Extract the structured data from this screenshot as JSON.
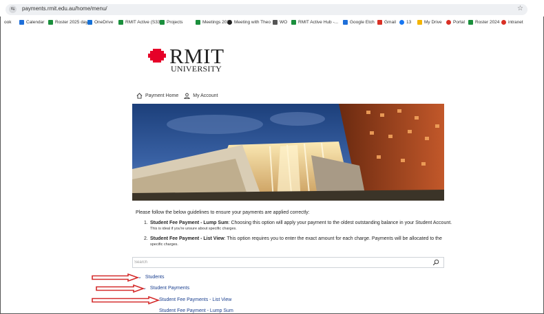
{
  "browser": {
    "url": "payments.rmit.edu.au/home/menu/",
    "bookmarks": [
      {
        "label": "ook",
        "color": "#ffffff"
      },
      {
        "label": "Calendar",
        "color": "#1e6fd9"
      },
      {
        "label": "Roster 2025 day",
        "color": "#1a8f3c"
      },
      {
        "label": "OneDrive",
        "color": "#1570d6"
      },
      {
        "label": "RMIT Active (S33)",
        "color": "#1a8f3c"
      },
      {
        "label": "Projects",
        "color": "#1a8f3c"
      },
      {
        "label": "Meetings 2025",
        "color": "#1a8f3c"
      },
      {
        "label": "Meeting with Theo",
        "color": "#222222"
      },
      {
        "label": "WO",
        "color": "#555555"
      },
      {
        "label": "RMIT Active Hub -...",
        "color": "#1a8f3c"
      },
      {
        "label": "Google Etch",
        "color": "#1e6fd9"
      },
      {
        "label": "Gmail",
        "color": "#d93025"
      },
      {
        "label": "13",
        "color": "#1877f2"
      },
      {
        "label": "My Drive",
        "color": "#f4b400"
      },
      {
        "label": "Portal",
        "color": "#d93025"
      },
      {
        "label": "Roster 2024",
        "color": "#1a8f3c"
      },
      {
        "label": "intranet",
        "color": "#d93025"
      }
    ]
  },
  "logo": {
    "name": "RMIT",
    "subtitle": "UNIVERSITY",
    "color": "#e60028"
  },
  "nav": {
    "home": "Payment Home",
    "account": "My Account"
  },
  "guidelines": {
    "intro": "Please follow the below guidelines to ensure your payments are applied correctly:",
    "items": [
      {
        "num": "1.",
        "title": "Student Fee Payment - Lump Sum",
        "desc": ": Choosing this option will apply your payment to the oldest outstanding balance in your Student Account.",
        "sub": "This is ideal if you're unsure about specific charges."
      },
      {
        "num": "2.",
        "title": "Student Fee Payment - List View",
        "desc": ": This option requires you to enter the exact amount for each charge. Payments will be allocated to the",
        "sub": "specific charges."
      }
    ]
  },
  "search": {
    "placeholder": "Search"
  },
  "tree": {
    "students": "Students",
    "student_payments": "Student Payments",
    "list_view": "Student Fee Payments - List View",
    "lump_sum": "Student Fee Payment - Lump Sum"
  },
  "colors": {
    "link": "#1a3f8f",
    "annotation_arrow": "#d42a2a"
  }
}
